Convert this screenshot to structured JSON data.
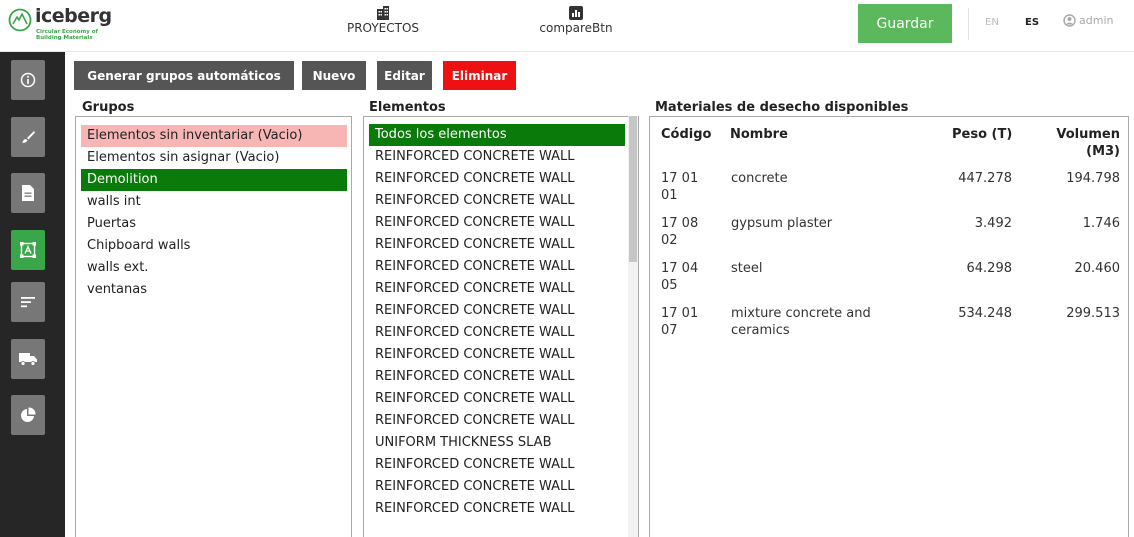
{
  "header": {
    "logo": {
      "name": "iceberg",
      "subtitle_line1": "Circular Economy of",
      "subtitle_line2": "Building Materials"
    },
    "nav": [
      {
        "label": "PROYECTOS",
        "icon": "building-icon"
      },
      {
        "label": "compareBtn",
        "icon": "bar-chart-icon"
      }
    ],
    "save_label": "Guardar",
    "languages": [
      "EN",
      "ES"
    ],
    "active_language": "ES",
    "user": "admin"
  },
  "sidebar": {
    "items": [
      {
        "icon": "info-icon",
        "active": false
      },
      {
        "icon": "brush-icon",
        "active": false
      },
      {
        "icon": "document-icon",
        "active": false
      },
      {
        "icon": "select-area-icon",
        "active": true
      },
      {
        "icon": "sort-lines-icon",
        "active": false
      },
      {
        "icon": "truck-icon",
        "active": false
      },
      {
        "icon": "pie-chart-icon",
        "active": false
      }
    ]
  },
  "toolbar": {
    "generate_label": "Generar grupos automáticos",
    "new_label": "Nuevo",
    "edit_label": "Editar",
    "delete_label": "Eliminar"
  },
  "groups": {
    "title": "Grupos",
    "items": [
      {
        "label": "Elementos sin inventariar (Vacio)",
        "state": "pink"
      },
      {
        "label": "Elementos sin asignar (Vacio)",
        "state": ""
      },
      {
        "label": "Demolition",
        "state": "selected"
      },
      {
        "label": "walls int",
        "state": ""
      },
      {
        "label": "Puertas",
        "state": ""
      },
      {
        "label": "Chipboard walls",
        "state": ""
      },
      {
        "label": "walls ext.",
        "state": ""
      },
      {
        "label": "ventanas",
        "state": ""
      }
    ]
  },
  "elements": {
    "title": "Elementos",
    "items": [
      {
        "label": "Todos los elementos",
        "state": "selected"
      },
      {
        "label": "REINFORCED CONCRETE WALL"
      },
      {
        "label": "REINFORCED CONCRETE WALL"
      },
      {
        "label": "REINFORCED CONCRETE WALL"
      },
      {
        "label": "REINFORCED CONCRETE WALL"
      },
      {
        "label": "REINFORCED CONCRETE WALL"
      },
      {
        "label": "REINFORCED CONCRETE WALL"
      },
      {
        "label": "REINFORCED CONCRETE WALL"
      },
      {
        "label": "REINFORCED CONCRETE WALL"
      },
      {
        "label": "REINFORCED CONCRETE WALL"
      },
      {
        "label": "REINFORCED CONCRETE WALL"
      },
      {
        "label": "REINFORCED CONCRETE WALL"
      },
      {
        "label": "REINFORCED CONCRETE WALL"
      },
      {
        "label": "REINFORCED CONCRETE WALL"
      },
      {
        "label": "UNIFORM THICKNESS SLAB"
      },
      {
        "label": "REINFORCED CONCRETE WALL"
      },
      {
        "label": "REINFORCED CONCRETE WALL"
      },
      {
        "label": "REINFORCED CONCRETE WALL"
      }
    ]
  },
  "materials": {
    "title": "Materiales de desecho disponibles",
    "columns": {
      "code": "Código",
      "name": "Nombre",
      "weight": "Peso (T)",
      "volume_line1": "Volumen",
      "volume_line2": "(M3)"
    },
    "rows": [
      {
        "code1": "17 01",
        "code2": "01",
        "name1": "concrete",
        "name2": "",
        "weight": "447.278",
        "volume": "194.798"
      },
      {
        "code1": "17 08",
        "code2": "02",
        "name1": "gypsum plaster",
        "name2": "",
        "weight": "3.492",
        "volume": "1.746"
      },
      {
        "code1": "17 04",
        "code2": "05",
        "name1": "steel",
        "name2": "",
        "weight": "64.298",
        "volume": "20.460"
      },
      {
        "code1": "17 01",
        "code2": "07",
        "name1": "mixture concrete and",
        "name2": "ceramics",
        "weight": "534.248",
        "volume": "299.513"
      }
    ]
  },
  "colors": {
    "accent_green": "#5cb85c",
    "selected_green": "#0a7a0a",
    "pink_highlight": "#f7b6b4",
    "delete_red": "#ee1111",
    "sidebar_bg": "#262626"
  }
}
